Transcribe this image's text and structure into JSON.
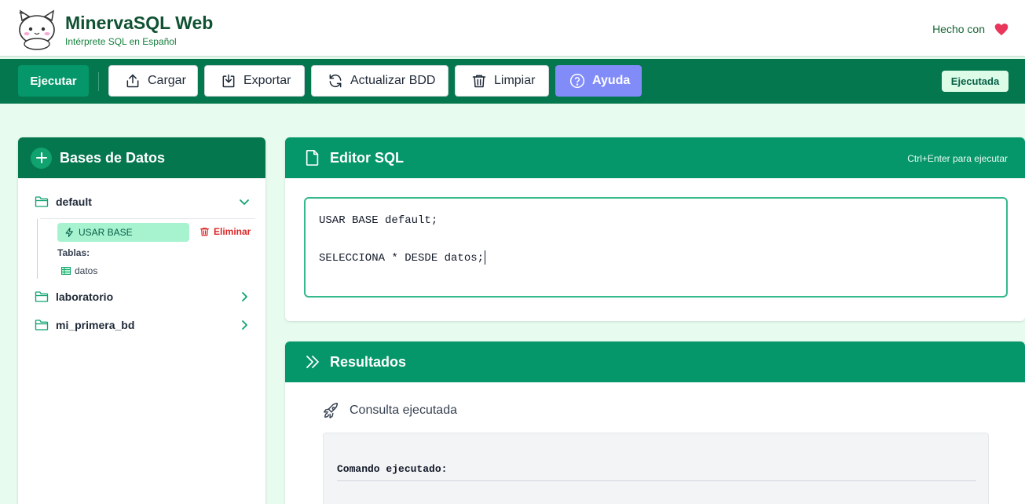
{
  "header": {
    "app_title": "MinervaSQL Web",
    "app_subtitle": "Intérprete SQL en Español",
    "made_with": "Hecho con",
    "logo_icon": "cat-logo-icon",
    "heart_icon": "heart-icon"
  },
  "toolbar": {
    "run_label": "Ejecutar",
    "load_label": "Cargar",
    "export_label": "Exportar",
    "refresh_label": "Actualizar BDD",
    "clear_label": "Limpiar",
    "help_label": "Ayuda",
    "status": "Ejecutada"
  },
  "sidebar": {
    "title": "Bases de Datos",
    "databases": [
      {
        "name": "default",
        "expanded": true,
        "use_label": "USAR BASE",
        "delete_label": "Eliminar",
        "tables_label": "Tablas:",
        "tables": [
          "datos"
        ]
      },
      {
        "name": "laboratorio",
        "expanded": false
      },
      {
        "name": "mi_primera_bd",
        "expanded": false
      }
    ]
  },
  "editor": {
    "title": "Editor SQL",
    "shortcut_hint": "Ctrl+Enter para ejecutar",
    "lines": [
      "USAR BASE default;",
      "",
      "SELECCIONA * DESDE datos;"
    ]
  },
  "results": {
    "title": "Resultados",
    "status": "Consulta ejecutada",
    "command_label": "Comando ejecutado:"
  },
  "colors": {
    "primary": "#059669",
    "primary_dark": "#05774f",
    "help": "#818cf8",
    "danger": "#dc2626",
    "background": "#e8fbef"
  }
}
